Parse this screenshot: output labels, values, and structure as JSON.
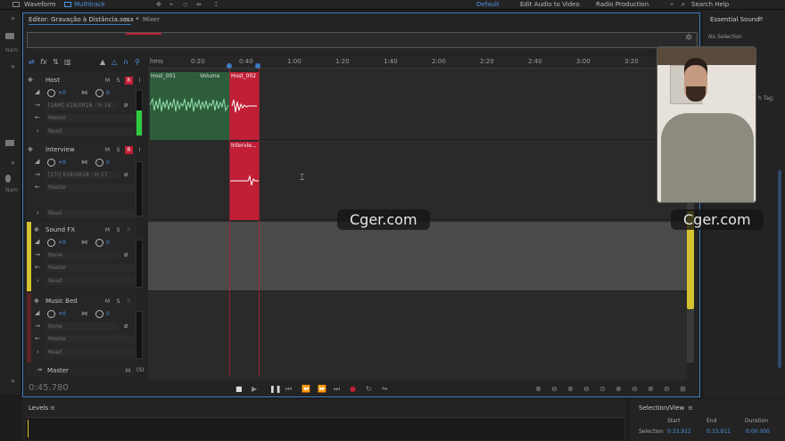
{
  "app": {
    "workspace_modes": [
      "Waveform",
      "Multitrack"
    ],
    "workspaces": [
      "Default",
      "Edit Audio to Video",
      "Radio Production"
    ],
    "search_placeholder": "Search Help"
  },
  "editor": {
    "tab_label": "Editor: Gravação à Distância.sesx *",
    "mixer_label": "Mixer",
    "ruler": {
      "unit": "hms",
      "labels": [
        "0:20",
        "0:40",
        "1:00",
        "1:20",
        "1:40",
        "2:00",
        "2:20",
        "2:40",
        "3:00",
        "3:20"
      ]
    },
    "time_display": "0:45.780"
  },
  "tracks": [
    {
      "name": "Host",
      "volume": "+0",
      "pan": "0",
      "input": "[1AM] X18/XR18 : In 16",
      "output": "Master",
      "mode": "Read",
      "color": "#3aa34a",
      "record_armed": true,
      "clips": [
        {
          "name": "Host_001",
          "effect": "Volume",
          "color": "#2e5d3c"
        },
        {
          "name": "Host_002",
          "color": "#c01f36"
        }
      ]
    },
    {
      "name": "Interview",
      "volume": "+0",
      "pan": "0",
      "input": "[17I] X18/XR18 : In 17",
      "output": "Master",
      "mode": "Read",
      "color": "#2b6e2f",
      "record_armed": true,
      "clips": [
        {
          "name": "Intervie...",
          "color": "#c01f36"
        }
      ]
    },
    {
      "name": "Sound FX",
      "volume": "+0",
      "pan": "0",
      "input": "None",
      "output": "Master",
      "mode": "Read",
      "color": "#d4c22e",
      "record_armed": false,
      "clips": []
    },
    {
      "name": "Music Bed",
      "volume": "+0",
      "pan": "0",
      "input": "None",
      "output": "Master",
      "mode": "Read",
      "color": "#7a2a2a",
      "record_armed": false,
      "clips": []
    }
  ],
  "master": {
    "name": "Master",
    "buttons": [
      "M",
      "(S)"
    ]
  },
  "track_buttons": {
    "mute": "M",
    "solo": "S",
    "record": "R",
    "input": "I"
  },
  "right_panel": {
    "title": "Essential Sound",
    "status": "No Selection",
    "fragment_text": "h Tag:"
  },
  "levels": {
    "title": "Levels"
  },
  "selection_view": {
    "title": "Selection/View",
    "headers": [
      "Start",
      "End",
      "Duration"
    ],
    "rows": [
      {
        "label": "Selection",
        "start": "0:33.911",
        "end": "0:33.911",
        "duration": "0:00.000"
      }
    ]
  },
  "left_strip": {
    "label": "Nam"
  },
  "watermarks": [
    "Cger.com",
    "Cger.com"
  ],
  "colors": {
    "accent": "#3e7ac1",
    "playhead": "#3e7ac1",
    "record": "#c01f36",
    "clip_green": "#2e5d3c"
  }
}
